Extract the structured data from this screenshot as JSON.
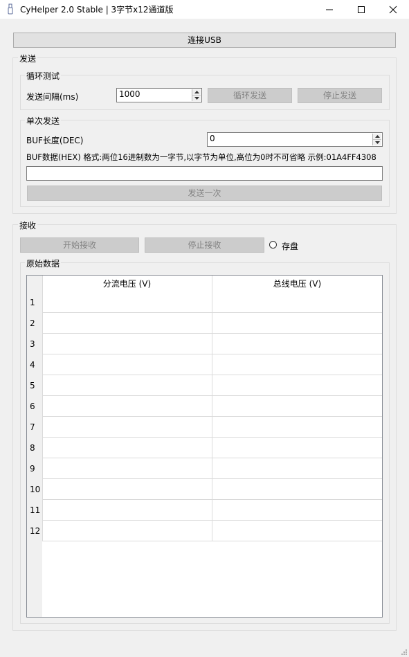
{
  "window": {
    "title": "CyHelper 2.0 Stable | 3字节x12通道版"
  },
  "toolbar": {
    "connect_label": "连接USB"
  },
  "send": {
    "group_label": "发送",
    "loop": {
      "group_label": "循环测试",
      "interval_label": "发送间隔(ms)",
      "interval_value": "1000",
      "loop_send_label": "循环发送",
      "stop_send_label": "停止发送"
    },
    "single": {
      "group_label": "单次发送",
      "buf_len_label": "BUF长度(DEC)",
      "buf_len_value": "0",
      "buf_data_label": "BUF数据(HEX) 格式:两位16进制数为一字节,以字节为单位,高位为0时不可省略 示例:01A4FF4308",
      "buf_data_value": "",
      "send_once_label": "发送一次"
    }
  },
  "receive": {
    "group_label": "接收",
    "start_label": "开始接收",
    "stop_label": "停止接收",
    "save_label": "存盘",
    "save_checked": false,
    "raw": {
      "group_label": "原始数据",
      "columns": [
        "分流电压 (V)",
        "总线电压 (V)"
      ],
      "rows": [
        "1",
        "2",
        "3",
        "4",
        "5",
        "6",
        "7",
        "8",
        "9",
        "10",
        "11",
        "12"
      ]
    }
  }
}
